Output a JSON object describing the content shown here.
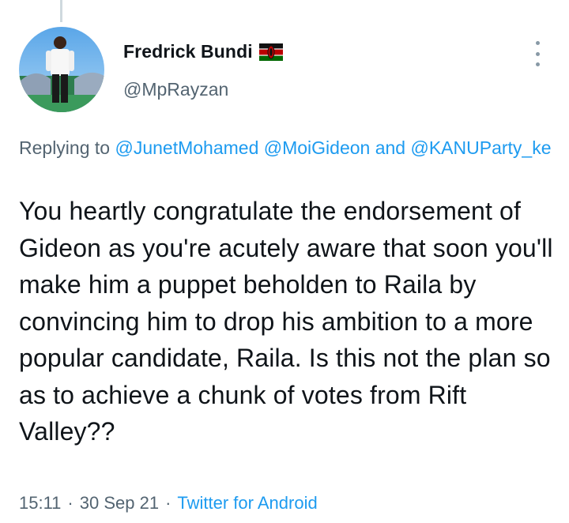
{
  "author": {
    "display_name": "Fredrick Bundi",
    "handle": "@MpRayzan",
    "flag_icon": "kenya-flag-icon"
  },
  "reply": {
    "prefix": "Replying to",
    "mentions": [
      "@JunetMohamed",
      "@MoiGideon",
      "@KANUParty_ke"
    ],
    "conjunction": "and"
  },
  "tweet": {
    "text": "You heartly congratulate the endorsement of Gideon as you're acutely aware that soon you'll make him a puppet beholden to Raila by convincing him to drop his ambition to a more popular candidate, Raila. Is this not the plan so as to achieve a chunk of votes from Rift Valley??"
  },
  "meta": {
    "time": "15:11",
    "separator": "·",
    "date": "30 Sep 21",
    "source": "Twitter for Android"
  },
  "colors": {
    "link": "#1d9bf0",
    "secondary_text": "#536471",
    "primary_text": "#0f1419"
  }
}
